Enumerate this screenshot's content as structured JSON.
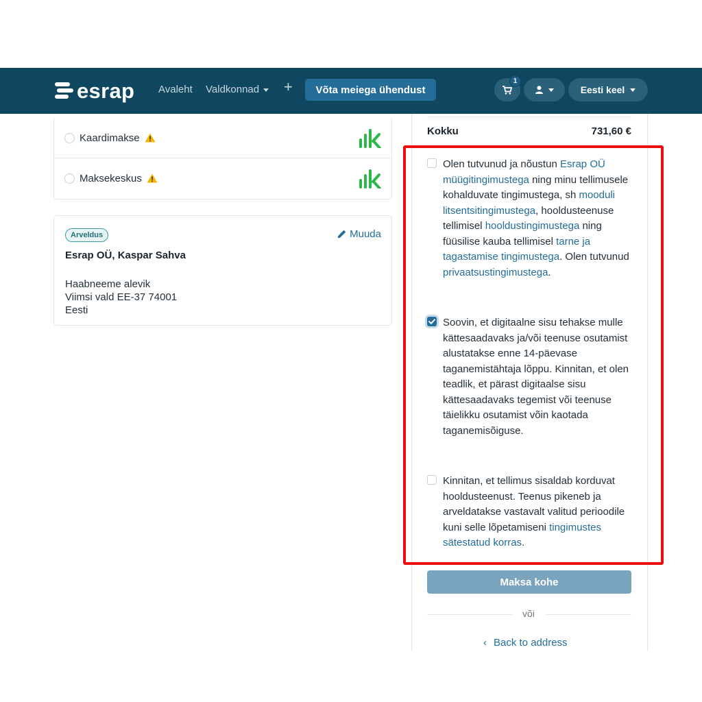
{
  "brand": {
    "logo_text": "esrap"
  },
  "nav": {
    "home": "Avaleht",
    "domains": "Valdkonnad",
    "plus": "+",
    "contact": "Võta meiega ühendust",
    "cart_count": "1",
    "language": "Eesti keel"
  },
  "payment_methods": [
    {
      "label": "Kaardimakse"
    },
    {
      "label": "Maksekeskus"
    }
  ],
  "billing": {
    "badge": "Arveldus",
    "edit": "Muuda",
    "name": "Esrap OÜ, Kaspar Sahva",
    "address": [
      "Haabneeme alevik",
      "Viimsi vald EE-37 74001",
      "Eesti"
    ]
  },
  "summary": {
    "total_label": "Kokku",
    "total_value": "731,60 €"
  },
  "terms": {
    "t1": {
      "a": "Olen tutvunud ja nõustun ",
      "link1": "Esrap OÜ müügitingimustega",
      "b": " ning minu tellimusele kohalduvate tingimustega, sh ",
      "link2": "mooduli litsentsitingimustega",
      "c": ", hooldusteenuse tellimisel ",
      "link3": "hooldustingimustega",
      "d": " ning füüsilise kauba tellimisel ",
      "link4": "tarne ja tagastamise tingimustega",
      "e": ". Olen tutvunud ",
      "link5": "privaatsustingimustega",
      "f": "."
    },
    "t2": {
      "text": "Soovin, et digitaalne sisu tehakse mulle kättesaadavaks ja/või teenuse osutamist alustatakse enne 14-päevase taganemistähtaja lõppu. Kinnitan, et olen teadlik, et pärast digitaalse sisu kättesaadavaks tegemist või teenuse täielikku osutamist võin kaotada taganemisõiguse."
    },
    "t3": {
      "a": "Kinnitan, et tellimus sisaldab korduvat hooldusteenust. Teenus pikeneb ja arveldatakse vastavalt valitud perioodile kuni selle lõpetamiseni ",
      "link": "tingimustes sätestatud korras",
      "b": "."
    }
  },
  "actions": {
    "pay": "Maksa kohe",
    "or": "või",
    "back_chevron": "‹",
    "back": "Back to address"
  },
  "colors": {
    "navbar": "#0f4660",
    "accent": "#236d98",
    "highlight": "#ee0d0d",
    "lhv_green": "#2bb84a",
    "warning": "#f2b705"
  }
}
